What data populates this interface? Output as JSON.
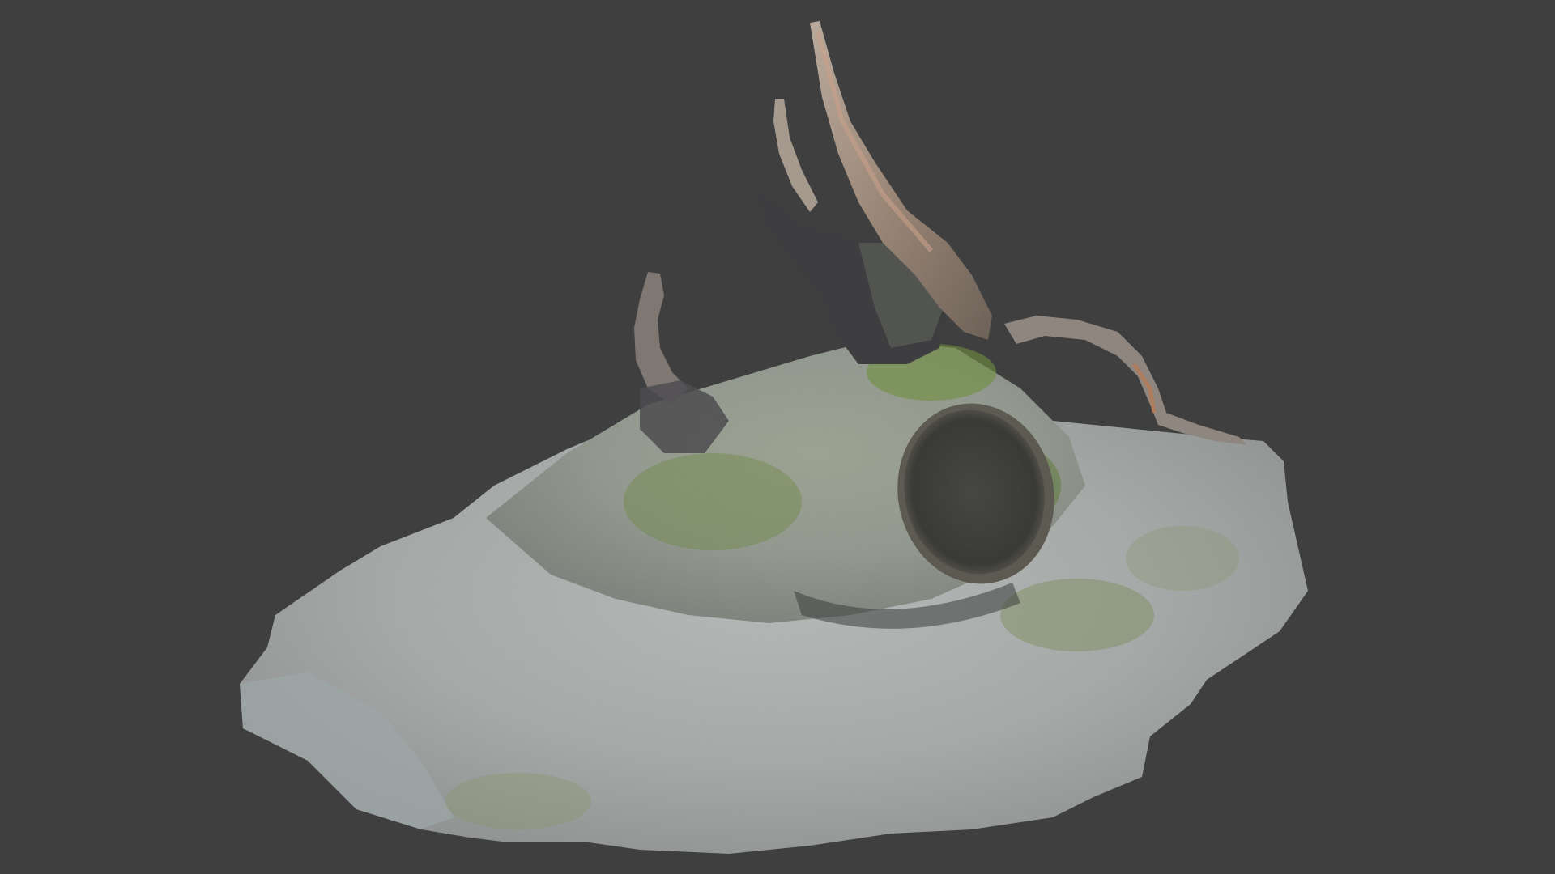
{
  "viewport": {
    "background_color": "#3f3f3f"
  },
  "model": {
    "kind": "photogrammetry-scan",
    "subject_icon": "tree-stump-icon",
    "colors": {
      "ground": "#a9adac",
      "ground_shadow": "#6f7371",
      "moss": "#6f8a4a",
      "bark": "#4a4a4e",
      "dead_wood": "#a99a8c",
      "cut_face": "#3a3a38"
    }
  }
}
